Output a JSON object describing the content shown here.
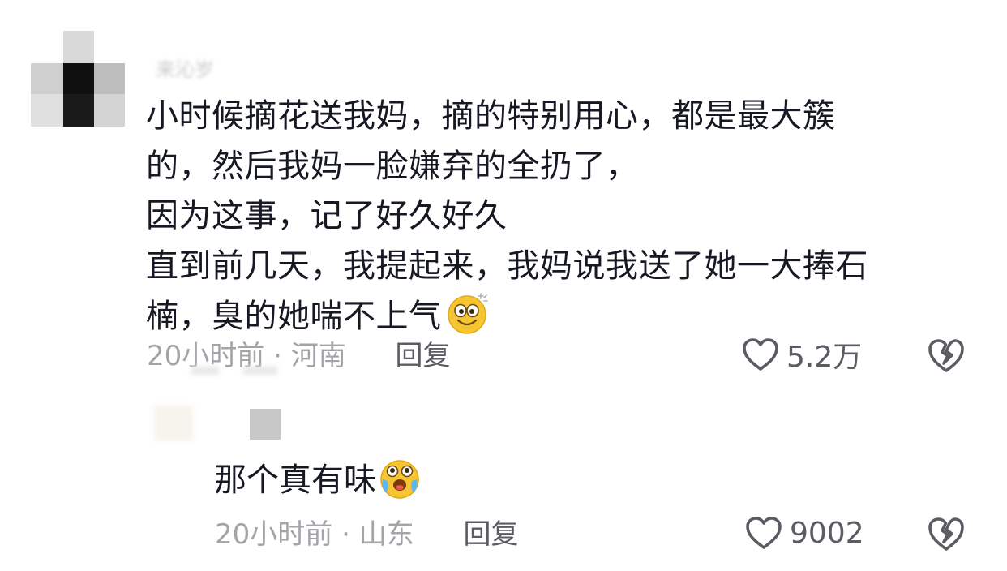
{
  "comment": {
    "username": "来沁岁",
    "lines": [
      "小时候摘花送我妈，摘的特别用心，都是最大簇",
      "的，然后我妈一脸嫌弃的全扔了，",
      "因为这事，记了好久好久",
      "直到前几天，我提起来，我妈说我送了她一大捧石",
      "楠，臭的她喘不上气"
    ],
    "emoji": "dizzy-smile-emoji",
    "time": "20小时前",
    "separator": "·",
    "location": "河南",
    "reply_label": "回复",
    "likes": "5.2万"
  },
  "reply": {
    "text": "那个真有味",
    "emoji": "laugh-cry-emoji",
    "time": "20小时前",
    "separator": "·",
    "location": "山东",
    "reply_label": "回复",
    "likes": "9002"
  },
  "icons": {
    "like": "heart-outline-icon",
    "dislike": "broken-heart-icon"
  },
  "colors": {
    "text": "#161823",
    "meta": "#a3a3a8",
    "action": "#5b5c63",
    "emoji_yellow": "#f7c531"
  }
}
